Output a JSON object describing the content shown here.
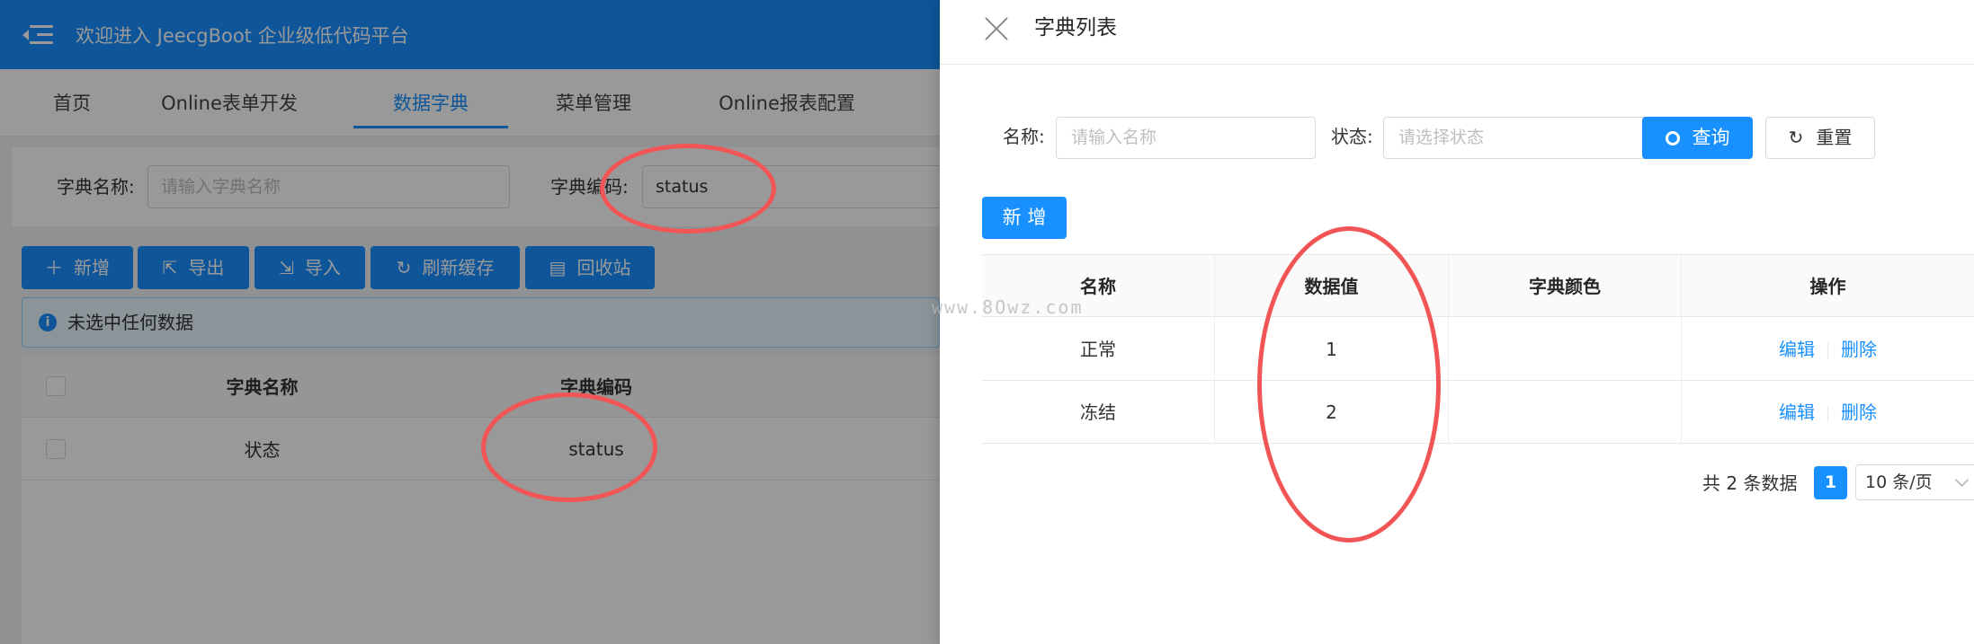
{
  "header": {
    "title": "欢迎进入 JeecgBoot 企业级低代码平台"
  },
  "nav_tabs": [
    {
      "label": "首页"
    },
    {
      "label": "Online表单开发"
    },
    {
      "label": "数据字典"
    },
    {
      "label": "菜单管理"
    },
    {
      "label": "Online报表配置"
    }
  ],
  "search": {
    "dict_name_label": "字典名称:",
    "dict_name_placeholder": "请输入字典名称",
    "dict_code_label": "字典编码:",
    "dict_code_value": "status"
  },
  "toolbar": {
    "add": "新增",
    "export": "导出",
    "import": "导入",
    "refresh": "刷新缓存",
    "recycle": "回收站"
  },
  "alert": {
    "text": "未选中任何数据"
  },
  "list_table": {
    "headers": [
      "字典名称",
      "字典编码"
    ],
    "rows": [
      [
        "状态",
        "status"
      ]
    ]
  },
  "drawer": {
    "title": "字典列表",
    "name_label": "名称:",
    "name_placeholder": "请输入名称",
    "status_label": "状态:",
    "status_placeholder": "请选择状态",
    "query_button": "查询",
    "reset_button": "重置",
    "add_button": "新 增",
    "table": {
      "headers": [
        "名称",
        "数据值",
        "字典颜色",
        "操作"
      ],
      "rows": [
        {
          "name": "正常",
          "value": "1",
          "color": "",
          "edit": "编辑",
          "delete": "删除"
        },
        {
          "name": "冻结",
          "value": "2",
          "color": "",
          "edit": "编辑",
          "delete": "删除"
        }
      ]
    },
    "pagination": {
      "total": "共 2 条数据",
      "current": "1",
      "page_size": "10 条/页"
    }
  },
  "watermark": "www.8Owz.com",
  "colors": {
    "primary": "#1890ff",
    "annotation": "#f25555"
  }
}
